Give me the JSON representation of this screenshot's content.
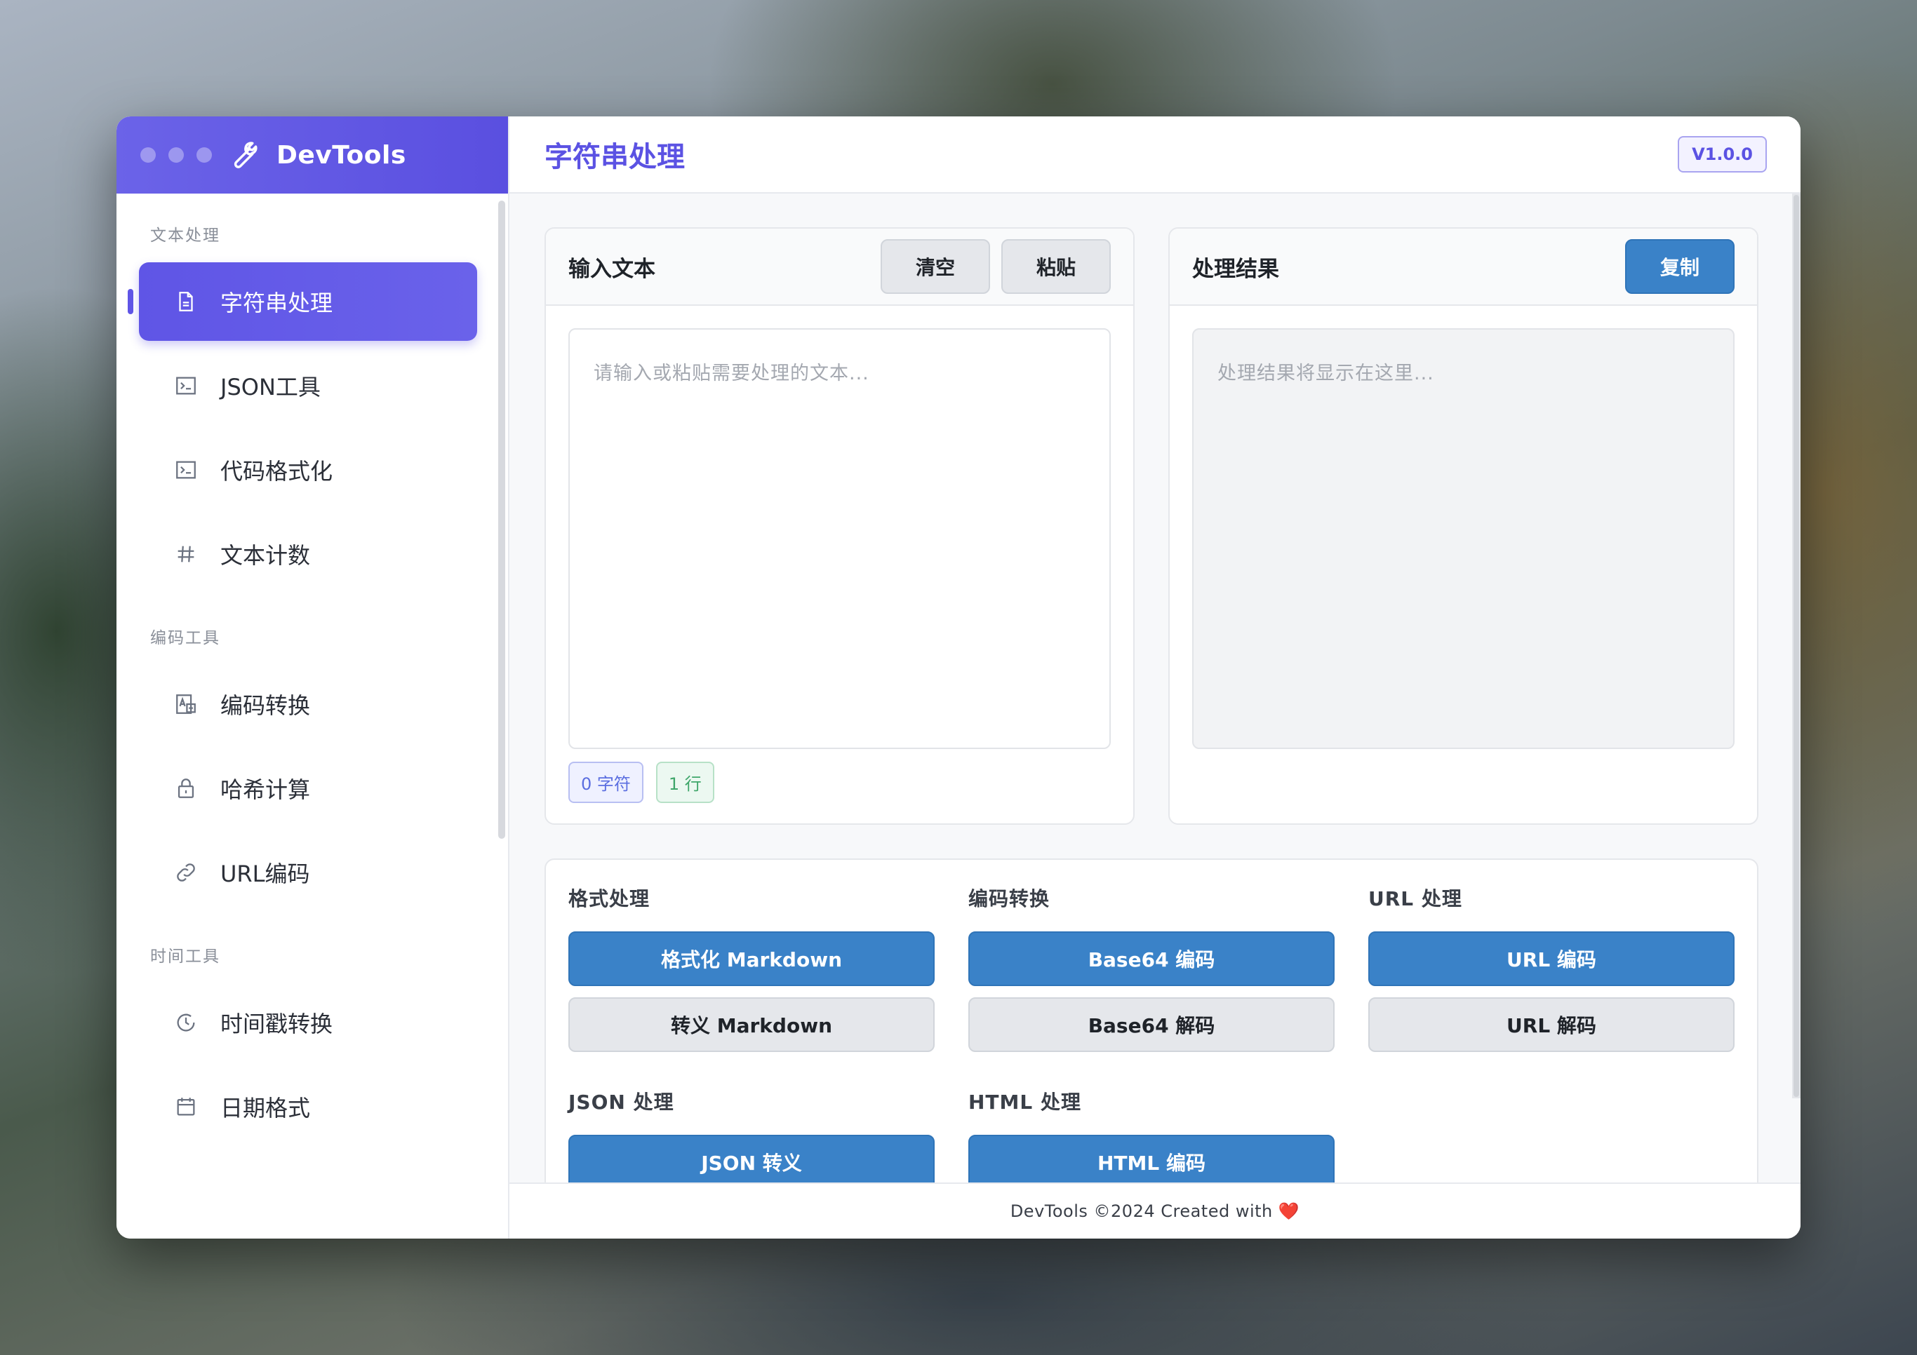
{
  "app": {
    "name": "DevTools",
    "version": "V1.0.0"
  },
  "sidebar": {
    "groups": [
      {
        "title": "文本处理",
        "items": [
          {
            "label": "字符串处理",
            "icon": "document-icon",
            "active": true
          },
          {
            "label": "JSON工具",
            "icon": "terminal-icon"
          },
          {
            "label": "代码格式化",
            "icon": "terminal-icon"
          },
          {
            "label": "文本计数",
            "icon": "hash-icon"
          }
        ]
      },
      {
        "title": "编码工具",
        "items": [
          {
            "label": "编码转换",
            "icon": "encode-icon"
          },
          {
            "label": "哈希计算",
            "icon": "lock-icon"
          },
          {
            "label": "URL编码",
            "icon": "link-icon"
          }
        ]
      },
      {
        "title": "时间工具",
        "items": [
          {
            "label": "时间戳转换",
            "icon": "clock-icon"
          },
          {
            "label": "日期格式",
            "icon": "calendar-icon"
          }
        ]
      }
    ]
  },
  "header": {
    "title": "字符串处理"
  },
  "input_panel": {
    "title": "输入文本",
    "clear_label": "清空",
    "paste_label": "粘贴",
    "placeholder": "请输入或粘贴需要处理的文本...",
    "char_count": "0 字符",
    "line_count": "1 行"
  },
  "output_panel": {
    "title": "处理结果",
    "copy_label": "复制",
    "placeholder": "处理结果将显示在这里..."
  },
  "operations": {
    "format": {
      "title": "格式处理",
      "primary": "格式化 Markdown",
      "secondary": "转义 Markdown"
    },
    "encode": {
      "title": "编码转换",
      "primary": "Base64 编码",
      "secondary": "Base64 解码"
    },
    "url": {
      "title": "URL 处理",
      "primary": "URL 编码",
      "secondary": "URL 解码"
    },
    "json": {
      "title": "JSON 处理",
      "primary": "JSON 转义"
    },
    "html": {
      "title": "HTML 处理",
      "primary": "HTML 编码"
    }
  },
  "footer": {
    "text": "DevTools ©2024 Created with",
    "heart": "❤️"
  },
  "colors": {
    "accent": "#5b52e3",
    "primary_button": "#3a82c8"
  }
}
